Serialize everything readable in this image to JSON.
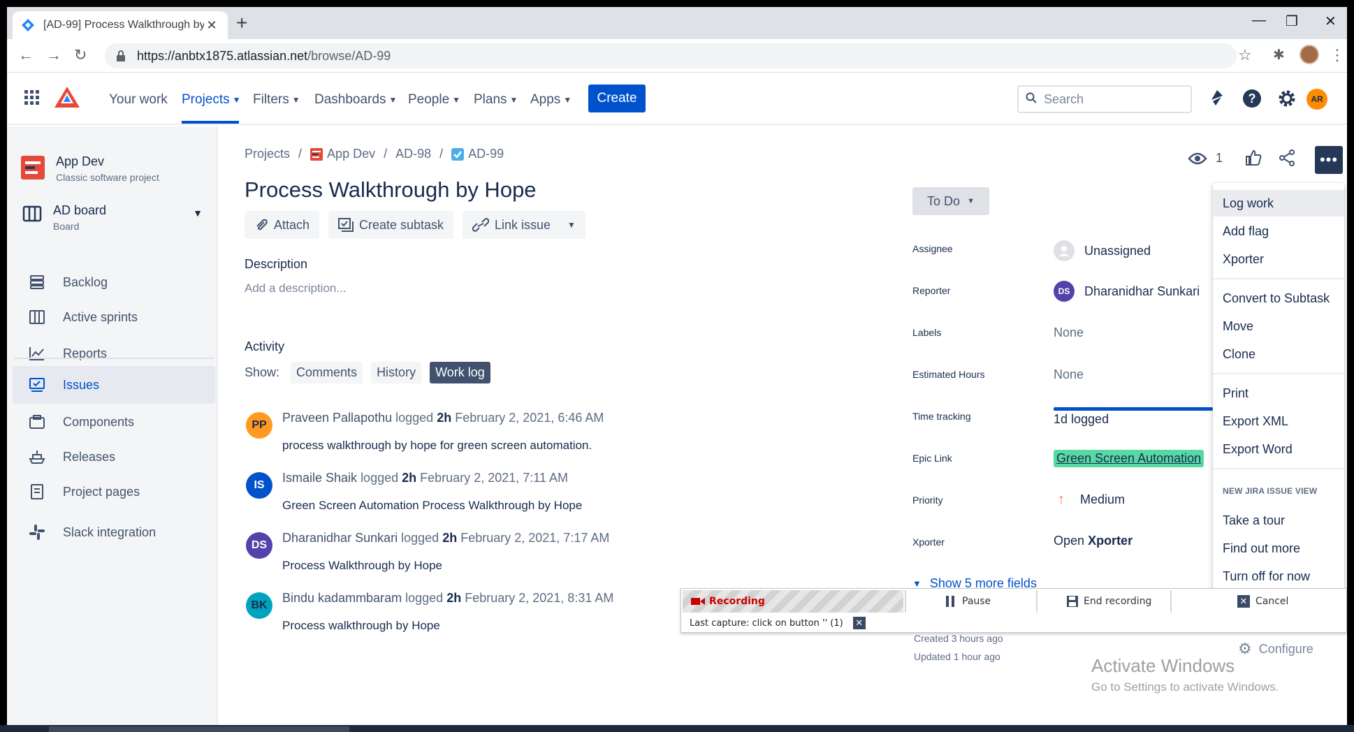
{
  "browser": {
    "tab_title": "[AD-99] Process Walkthrough by",
    "url_host": "https://anbtx1875.atlassian.net",
    "url_path": "/browse/AD-99"
  },
  "jira_nav": {
    "items": [
      "Your work",
      "Projects",
      "Filters",
      "Dashboards",
      "People",
      "Plans",
      "Apps"
    ],
    "active": "Projects",
    "create_label": "Create",
    "search_placeholder": "Search",
    "avatar_initials": "AR"
  },
  "sidebar": {
    "project_name": "App Dev",
    "project_type": "Classic software project",
    "board_name": "AD board",
    "board_type": "Board",
    "items": [
      {
        "label": "Backlog",
        "icon": "backlog-icon"
      },
      {
        "label": "Active sprints",
        "icon": "sprints-icon"
      },
      {
        "label": "Reports",
        "icon": "reports-icon"
      },
      {
        "label": "Issues",
        "icon": "issues-icon",
        "selected": true
      },
      {
        "label": "Components",
        "icon": "components-icon"
      },
      {
        "label": "Releases",
        "icon": "releases-icon"
      },
      {
        "label": "Project pages",
        "icon": "pages-icon"
      },
      {
        "label": "Slack integration",
        "icon": "slack-icon"
      }
    ]
  },
  "breadcrumb": {
    "projects": "Projects",
    "project": "App Dev",
    "parent": "AD-98",
    "issue": "AD-99"
  },
  "issue": {
    "title": "Process Walkthrough by Hope",
    "actions": [
      "Attach",
      "Create subtask",
      "Link issue"
    ],
    "description_heading": "Description",
    "description_placeholder": "Add a description...",
    "watchers": "1"
  },
  "activity": {
    "heading": "Activity",
    "show_label": "Show:",
    "filters": [
      "Comments",
      "History",
      "Work log"
    ],
    "active_filter": "Work log",
    "entries": [
      {
        "initials": "PP",
        "color": "#FF991F",
        "author": "Praveen Pallapothu",
        "logged": "logged",
        "duration": "2h",
        "date": "February 2, 2021, 6:46 AM",
        "text": "process walkthrough by hope for green screen automation."
      },
      {
        "initials": "IS",
        "color": "#0052CC",
        "author": "Ismaile Shaik",
        "logged": "logged",
        "duration": "2h",
        "date": "February 2, 2021, 7:11 AM",
        "text": "Green Screen Automation Process Walkthrough by Hope"
      },
      {
        "initials": "DS",
        "color": "#5243AA",
        "author": "Dharanidhar Sunkari",
        "logged": "logged",
        "duration": "2h",
        "date": "February 2, 2021, 7:17 AM",
        "text": "Process Walkthrough by Hope"
      },
      {
        "initials": "BK",
        "color": "#00A3BF",
        "author": "Bindu kadammbaram",
        "logged": "logged",
        "duration": "2h",
        "date": "February 2, 2021, 8:31 AM",
        "text": "Process walkthrough by Hope"
      }
    ]
  },
  "details": {
    "status": "To Do",
    "fields": [
      {
        "label": "Assignee",
        "value": "Unassigned"
      },
      {
        "label": "Reporter",
        "value": "Dharanidhar Sunkari",
        "initials": "DS"
      },
      {
        "label": "Labels",
        "value": "None"
      },
      {
        "label": "Estimated Hours",
        "value": "None"
      },
      {
        "label": "Time tracking",
        "value": "1d logged"
      },
      {
        "label": "Epic Link",
        "value": "Green Screen Automation"
      },
      {
        "label": "Priority",
        "value": "Medium"
      },
      {
        "label": "Xporter",
        "value_prefix": "Open",
        "value": "Xporter"
      }
    ],
    "more_fields": "Show 5 more fields",
    "created": "Created 3 hours ago",
    "updated": "Updated 1 hour ago",
    "configure": "Configure"
  },
  "more_menu": {
    "group1": [
      "Log work",
      "Add flag",
      "Xporter"
    ],
    "group2": [
      "Convert to Subtask",
      "Move",
      "Clone"
    ],
    "group3": [
      "Print",
      "Export XML",
      "Export Word"
    ],
    "heading": "NEW JIRA ISSUE VIEW",
    "group4": [
      "Take a tour",
      "Find out more",
      "Turn off for now"
    ]
  },
  "recorder": {
    "status": "Recording",
    "pause": "Pause",
    "end": "End recording",
    "cancel": "Cancel",
    "last_capture": "Last capture: click on button '' (1)"
  },
  "watermark": {
    "title": "Activate Windows",
    "subtitle": "Go to Settings to activate Windows."
  }
}
